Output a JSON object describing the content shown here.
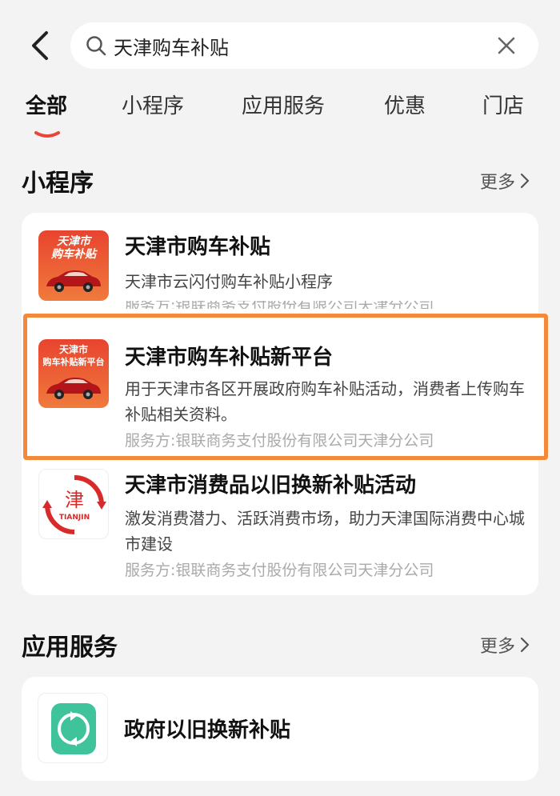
{
  "search": {
    "query": "天津购车补贴"
  },
  "tabs": [
    "全部",
    "小程序",
    "应用服务",
    "优惠",
    "门店"
  ],
  "sections": {
    "mini_programs": {
      "title": "小程序",
      "more": "更多"
    },
    "app_services": {
      "title": "应用服务",
      "more": "更多"
    }
  },
  "mini_programs": [
    {
      "thumb_text": [
        "天津市",
        "购车补贴"
      ],
      "title": "天津市购车补贴",
      "desc": "天津市云闪付购车补贴小程序",
      "provider": "服务方:银联商务支付股份有限公司天津分公司"
    },
    {
      "thumb_text": [
        "天津市",
        "购车补贴新平台"
      ],
      "title": "天津市购车补贴新平台",
      "desc": "用于天津市各区开展政府购车补贴活动，消费者上传购车补贴相关资料。",
      "provider": "服务方:银联商务支付股份有限公司天津分公司"
    },
    {
      "thumb_text": [
        "津",
        "TIANJIN"
      ],
      "title": "天津市消费品以旧换新补贴活动",
      "desc": "激发消费潜力、活跃消费市场，助力天津国际消费中心城市建设",
      "provider": "服务方:银联商务支付股份有限公司天津分公司"
    }
  ],
  "app_services": [
    {
      "title": "政府以旧换新补贴",
      "icon": "refresh-swap-icon"
    }
  ],
  "colors": {
    "accent": "#e8463a",
    "highlight": "#f5893a",
    "service_icon": "#3fc39a"
  }
}
